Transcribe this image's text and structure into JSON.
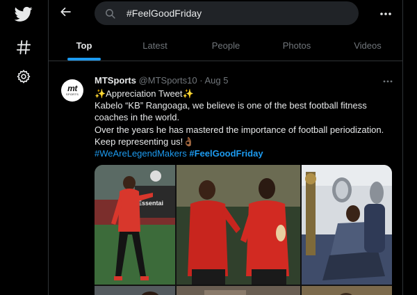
{
  "rail": {
    "logo_icon": "twitter-bird-icon",
    "explore_icon": "hashtag-icon",
    "settings_icon": "gear-icon"
  },
  "search": {
    "query": "#FeelGoodFriday"
  },
  "tabs": [
    {
      "label": "Top",
      "active": true
    },
    {
      "label": "Latest",
      "active": false
    },
    {
      "label": "People",
      "active": false
    },
    {
      "label": "Photos",
      "active": false
    },
    {
      "label": "Videos",
      "active": false
    }
  ],
  "tweet": {
    "avatar_mark": "mt",
    "avatar_sub": "SPORTS",
    "author_name": "MTSports",
    "author_handle": "@MTSports10",
    "separator": "·",
    "date": "Aug 5",
    "lines": [
      "✨Appreciation Tweet✨",
      "Kabelo “KB” Rangoaga, we believe is one of the best football fitness",
      "coaches in the world.",
      "Over the years he has mastered the importance of football periodization.",
      "Keep representing us!👌🏾"
    ],
    "hashtags": [
      "#WeAreLegendMakers",
      "#FeelGoodFriday"
    ],
    "photo_sign_text": "Essentai"
  },
  "colors": {
    "background": "#000000",
    "accent": "#1d9bf0",
    "text_primary": "#e7e9ea",
    "text_secondary": "#71767b",
    "border": "#2f3336",
    "search_bg": "#202327"
  }
}
